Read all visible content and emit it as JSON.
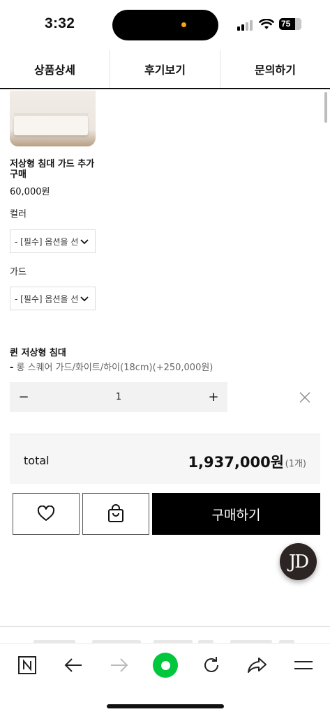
{
  "status": {
    "time": "3:32",
    "battery": "75"
  },
  "tabs": [
    {
      "label": "상품상세"
    },
    {
      "label": "후기보기"
    },
    {
      "label": "문의하기"
    }
  ],
  "product": {
    "name": "저상형 침대 가드 추가구매",
    "price": "60,000원",
    "options": [
      {
        "label": "컬러",
        "placeholder": "- [필수] 옵션을 선"
      },
      {
        "label": "가드",
        "placeholder": "- [필수] 옵션을 선"
      }
    ]
  },
  "selection": {
    "title": "퀸 저상형 침대",
    "prefix": "-",
    "option": "롱 스퀘어 가드/화이트/하이(18cm)(+250,000원)",
    "quantity": "1",
    "minus": "−",
    "plus": "+"
  },
  "total": {
    "label": "total",
    "amount": "1,937,000원",
    "count": "(1개)"
  },
  "actions": {
    "buy_label": "구매하기"
  },
  "chat_fab": {
    "label": "JD"
  },
  "colors": {
    "accent": "#000000",
    "browser_green": "#00c73c",
    "fab": "#2d2523"
  },
  "icons": [
    "heart-icon",
    "cart-icon",
    "close-icon",
    "chevron-down-icon",
    "naver-n-icon",
    "back-arrow-icon",
    "forward-arrow-icon",
    "reload-icon",
    "share-icon",
    "menu-icon"
  ]
}
